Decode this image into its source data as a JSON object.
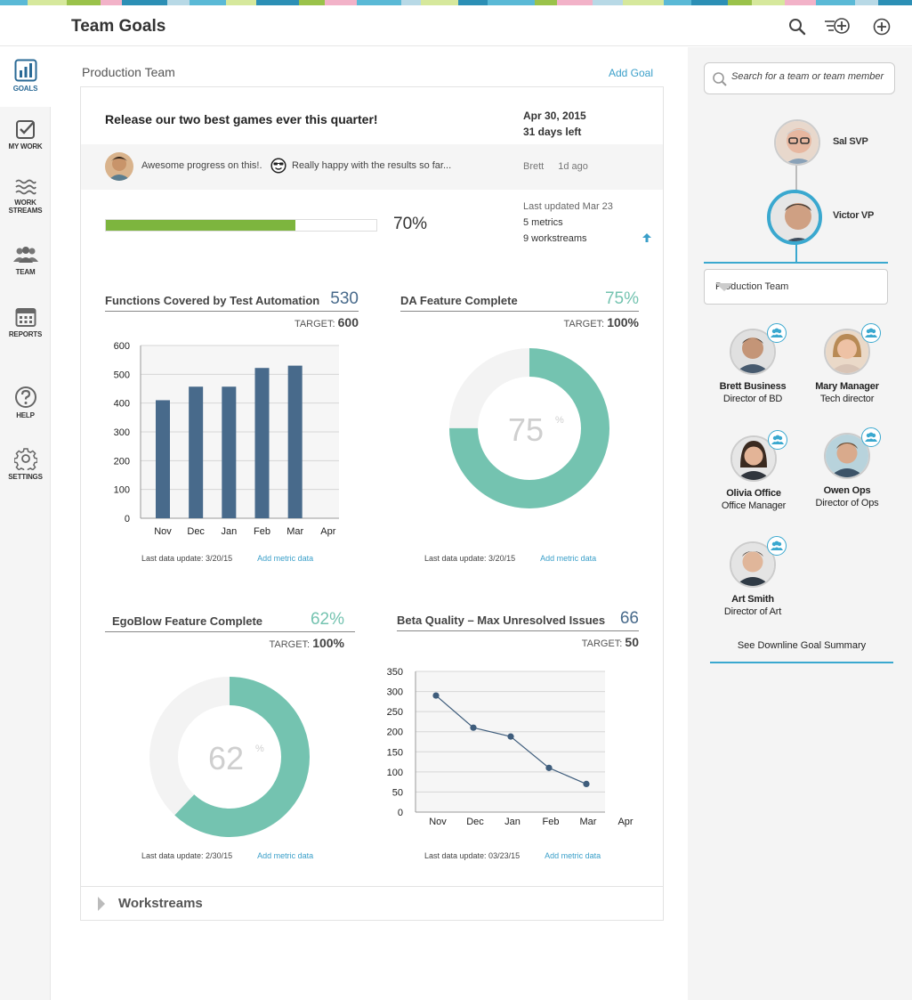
{
  "colors": {
    "accent": "#3a9fc9",
    "progress": "#7db53e",
    "bar": "#486a8b",
    "donut": "#74c3b0",
    "donut_track": "#f3f3f3",
    "line": "#3f5d7c",
    "stripe": [
      "#5ab9d6",
      "#d6e89c",
      "#9ac24a",
      "#f2b2c8",
      "#2c8fb5",
      "#b8d9e6"
    ]
  },
  "header": {
    "title": "Team Goals",
    "icons": [
      "search-icon",
      "add-list-icon",
      "add-icon"
    ]
  },
  "nav": {
    "items": [
      {
        "label": "GOALS",
        "icon": "goals-icon",
        "active": true
      },
      {
        "label": "MY WORK",
        "icon": "mywork-icon"
      },
      {
        "label_1": "WORK",
        "label_2": "STREAMS",
        "icon": "workstreams-icon"
      },
      {
        "label": "TEAM",
        "icon": "team-icon"
      },
      {
        "label": "REPORTS",
        "icon": "calendar-icon"
      },
      {
        "label": "HELP",
        "icon": "help-icon"
      },
      {
        "label": "SETTINGS",
        "icon": "gear-icon"
      }
    ]
  },
  "main": {
    "team_title": "Production Team",
    "add_goal": "Add Goal",
    "goal": {
      "title": "Release our two best games ever this quarter!",
      "date": "Apr 30, 2015",
      "days_left": "31 days left",
      "comment_1": "Awesome progress on this!.",
      "comment_2": "Really happy with the results so far...",
      "comment_author": "Brett",
      "comment_time": "1d ago",
      "progress": 70,
      "progress_label": "70%",
      "last_updated": "Last updated Mar 23",
      "metrics_count": "5 metrics",
      "workstreams_count": "9 workstreams"
    },
    "metrics": [
      {
        "name": "Functions Covered by Test Automation",
        "value": "530",
        "target_label": "TARGET:",
        "target": "600",
        "last_update": "Last data update: 3/20/15",
        "link": "Add metric data"
      },
      {
        "name": "DA Feature Complete",
        "value": "75%",
        "target_label": "TARGET:",
        "target": "100%",
        "last_update": "Last data update: 3/20/15",
        "link": "Add metric data",
        "center": "75",
        "center_unit": "%"
      },
      {
        "name": "EgoBlow Feature Complete",
        "value": "62%",
        "target_label": "TARGET:",
        "target": "100%",
        "last_update": "Last data update: 2/30/15",
        "link": "Add metric data",
        "center": "62",
        "center_unit": "%"
      },
      {
        "name": "Beta Quality – Max Unresolved Issues",
        "value": "66",
        "target_label": "TARGET:",
        "target": "50",
        "last_update": "Last data update: 03/23/15",
        "link": "Add metric data"
      }
    ],
    "workstreams_label": "Workstreams"
  },
  "chart_data": [
    {
      "type": "bar",
      "title": "Functions Covered by Test Automation",
      "categories": [
        "Nov",
        "Dec",
        "Jan",
        "Feb",
        "Mar",
        "Apr"
      ],
      "values": [
        410,
        457,
        457,
        522,
        530,
        null
      ],
      "yticks": [
        0,
        100,
        200,
        300,
        400,
        500,
        600
      ],
      "ylim": [
        0,
        600
      ],
      "grid": true
    },
    {
      "type": "pie",
      "title": "DA Feature Complete",
      "values": [
        75,
        25
      ]
    },
    {
      "type": "pie",
      "title": "EgoBlow Feature Complete",
      "values": [
        62,
        38
      ]
    },
    {
      "type": "line",
      "title": "Beta Quality – Max Unresolved Issues",
      "categories": [
        "Nov",
        "Dec",
        "Jan",
        "Feb",
        "Mar",
        "Apr"
      ],
      "values": [
        290,
        210,
        188,
        110,
        70,
        null
      ],
      "yticks": [
        0,
        50,
        100,
        150,
        200,
        250,
        300,
        350
      ],
      "ylim": [
        0,
        350
      ],
      "grid": true
    }
  ],
  "right": {
    "search_placeholder": "Search for a team or team member",
    "svp": "Sal SVP",
    "vp": "Victor VP",
    "team_select": "Production Team",
    "members": [
      {
        "name": "Brett Business",
        "role": "Director of BD"
      },
      {
        "name": "Mary Manager",
        "role": "Tech director"
      },
      {
        "name": "Olivia Office",
        "role": "Office Manager"
      },
      {
        "name": "Owen Ops",
        "role": "Director of Ops"
      },
      {
        "name": "Art Smith",
        "role": "Director of Art"
      }
    ],
    "downline": "See Downline Goal Summary"
  }
}
